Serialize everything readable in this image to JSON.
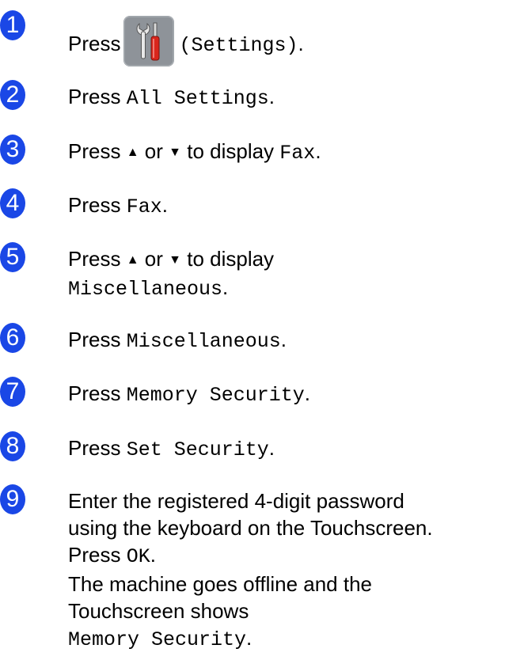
{
  "colors": {
    "badge": "#1a47e6",
    "icon_bg": "#8e9399",
    "icon_handle": "#d9261c"
  },
  "steps": [
    {
      "num": "1",
      "press": "Press",
      "settings_label": "(Settings)",
      "end": "."
    },
    {
      "num": "2",
      "press": "Press",
      "code": "All Settings",
      "end": "."
    },
    {
      "num": "3",
      "text": "Press",
      "up": "▲",
      "or": "or",
      "down": "▼",
      "display": "to display",
      "code": "Fax",
      "end": "."
    },
    {
      "num": "4",
      "press": "Press",
      "code": "Fax",
      "end": "."
    },
    {
      "num": "5",
      "text": "Press",
      "up": "▲",
      "or": "or",
      "down": "▼",
      "display": "to display",
      "code": "Miscellaneous",
      "end": "."
    },
    {
      "num": "6",
      "press": "Press",
      "code": "Miscellaneous",
      "end": "."
    },
    {
      "num": "7",
      "press": "Press",
      "code": "Memory Security",
      "end": "."
    },
    {
      "num": "8",
      "press": "Press",
      "code": "Set Security",
      "end": "."
    },
    {
      "num": "9",
      "line1": "Enter the registered 4-digit password",
      "line2": "using the keyboard on the Touchscreen.",
      "press": "Press",
      "ok": "OK",
      "ok_end": ".",
      "line4": "The machine goes offline and the",
      "line5": "Touchscreen shows",
      "code": "Memory Security",
      "end": "."
    }
  ]
}
